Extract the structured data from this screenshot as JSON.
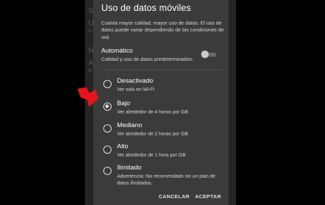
{
  "background": {
    "glyphs": [
      "S",
      "U",
      "A",
      "N",
      "A",
      "A"
    ]
  },
  "dialog": {
    "title": "Uso de datos móviles",
    "description": "Cuanta mayor calidad, mayor uso de datos. El uso de datos puede variar dependiendo de las condiciones de red.",
    "auto": {
      "title": "Automático",
      "subtitle": "Calidad y uso de datos predeterminados.",
      "toggle_on": false
    },
    "options": [
      {
        "title": "Desactivado",
        "subtitle": "Ver solo en Wi-Fi",
        "selected": false
      },
      {
        "title": "Bajo",
        "subtitle": "Ver alrededor de 4 horas por GB",
        "selected": true
      },
      {
        "title": "Mediano",
        "subtitle": "Ver alrededor de 2 horas por GB",
        "selected": false
      },
      {
        "title": "Alto",
        "subtitle": "Ver alrededor de 1 hora por GB",
        "selected": false
      },
      {
        "title": "Ilimitado",
        "subtitle": "Advertencia: No recomendado sin un plan de datos ilimitados.",
        "selected": false
      }
    ],
    "cancel_label": "CANCELAR",
    "accept_label": "ACEPTAR"
  },
  "annotation": {
    "icon": "red-arrow-icon",
    "color": "#e8141b"
  },
  "colors": {
    "dialog_bg": "#3b3b3b",
    "screen_bg": "#242424",
    "text_primary": "#ffffff",
    "text_secondary": "#d6d6d6"
  }
}
